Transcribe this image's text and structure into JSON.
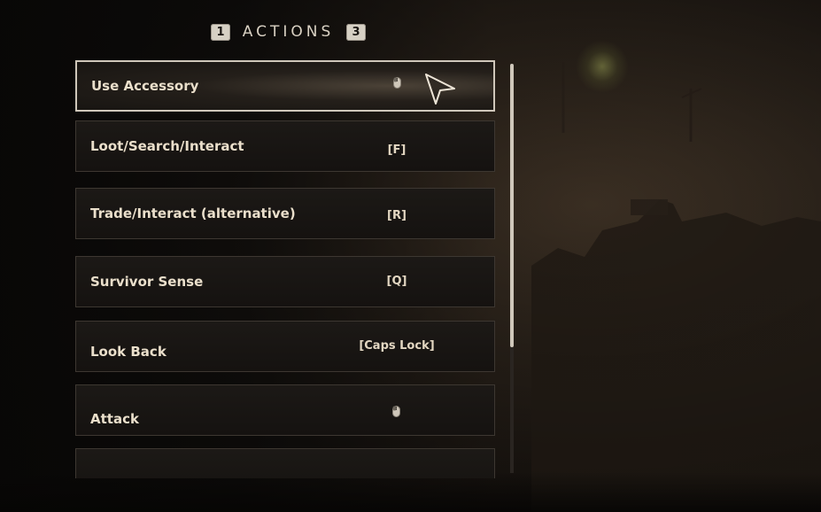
{
  "header": {
    "left_key": "1",
    "title": "ACTIONS",
    "right_key": "3"
  },
  "actions": [
    {
      "label": "Use Accessory",
      "key": "",
      "key_icon": "mouse-icon",
      "selected": true
    },
    {
      "label": "Loot/Search/Interact",
      "key": "[F]"
    },
    {
      "label": "Trade/Interact (alternative)",
      "key": "[R]"
    },
    {
      "label": "Survivor Sense",
      "key": "[Q]"
    },
    {
      "label": "Look Back",
      "key": "[Caps Lock]"
    },
    {
      "label": "Attack",
      "key": "",
      "key_icon": "mouse-icon"
    }
  ],
  "colors": {
    "accent_border": "#cfc7ba",
    "text": "#eadfcb"
  }
}
